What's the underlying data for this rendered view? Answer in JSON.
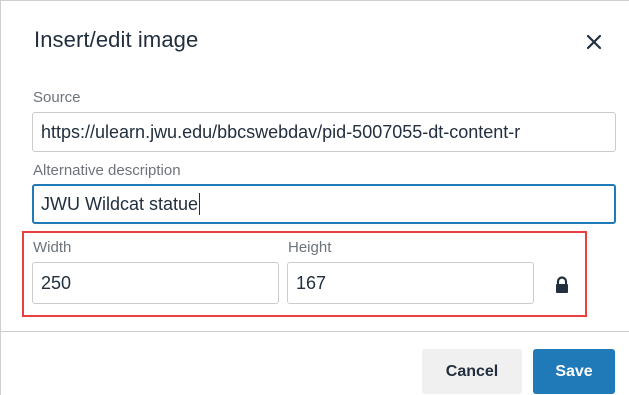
{
  "dialog": {
    "title": "Insert/edit image",
    "close_icon": "close-icon"
  },
  "fields": {
    "source": {
      "label": "Source",
      "value": "https://ulearn.jwu.edu/bbcswebdav/pid-5007055-dt-content-r"
    },
    "alt": {
      "label": "Alternative description",
      "value": "JWU Wildcat statue"
    },
    "width": {
      "label": "Width",
      "value": "250"
    },
    "height": {
      "label": "Height",
      "value": "167"
    },
    "lock_icon": "lock-icon"
  },
  "buttons": {
    "cancel": "Cancel",
    "save": "Save"
  },
  "colors": {
    "accent": "#207ab7",
    "highlight": "#e8403f"
  }
}
